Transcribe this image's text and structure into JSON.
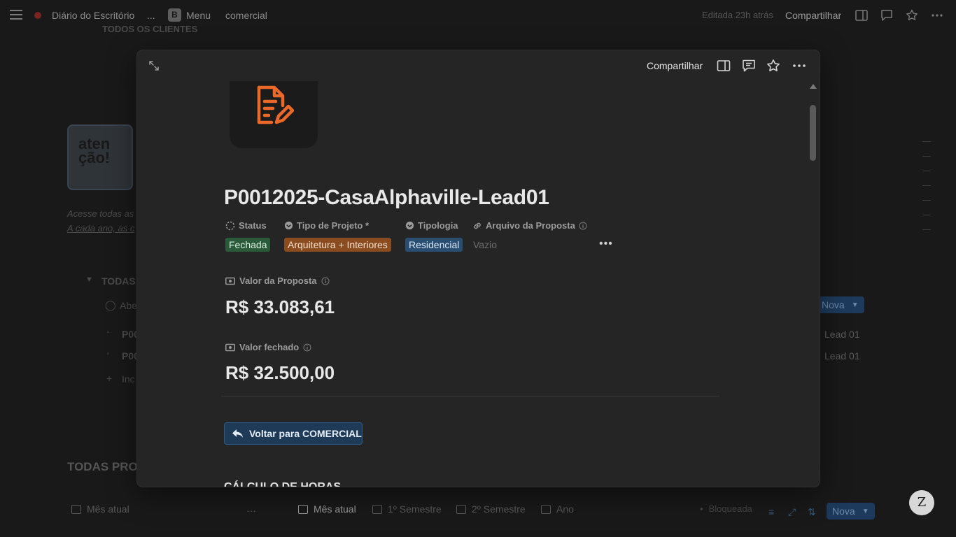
{
  "topbar": {
    "breadcrumb_1": "Diário do Escritório",
    "ellipsis": "...",
    "menu_icon_letter": "B",
    "breadcrumb_2": "Menu",
    "breadcrumb_3": "comercial",
    "edited": "Editada 23h atrás",
    "share_label": "Compartilhar"
  },
  "background": {
    "section_top": "TODOS OS CLIENTES",
    "atencao": "aten ção!",
    "italic_line_1": "Acesse todas as",
    "italic_line_2": "A cada ano, as c",
    "todas_heading": "TODAS A",
    "row_abe": "Abe",
    "row_p1": "P00",
    "row_p2": "P00",
    "row_inc": "Inc",
    "lead_1": "Lead 01",
    "lead_2": "Lead 01",
    "nova_label": "Nova",
    "todas_prop": "TODAS PROP",
    "bottom_left_view": "Mês atual",
    "tabs": [
      "Mês atual",
      "1º Semestre",
      "2º Semestre",
      "Ano"
    ],
    "bottom_right_text": "Bloqueada",
    "bottom_nova": "Nova",
    "avatar_letter": "Z"
  },
  "modal": {
    "share_label": "Compartilhar",
    "title": "P0012025-CasaAlphaville-Lead01",
    "properties": {
      "status_label": "Status",
      "status_value": "Fechada",
      "tipo_label": "Tipo de Projeto *",
      "tipo_value": "Arquitetura + Interiores",
      "tipologia_label": "Tipologia",
      "tipologia_value": "Residencial",
      "arquivo_label": "Arquivo da Proposta",
      "arquivo_value": "Vazio"
    },
    "valor_proposta_label": "Valor da Proposta",
    "valor_proposta": "R$ 33.083,61",
    "valor_fechado_label": "Valor fechado",
    "valor_fechado": "R$ 32.500,00",
    "back_button": "Voltar para COMERCIAL",
    "next_section": "CÁLCULO DE HORAS"
  },
  "colors": {
    "status_green": "#2b5a3b",
    "tipo_orange": "#8a4b1f",
    "tipologia_blue": "#2a4e72",
    "page_icon_orange": "#e8692a"
  }
}
